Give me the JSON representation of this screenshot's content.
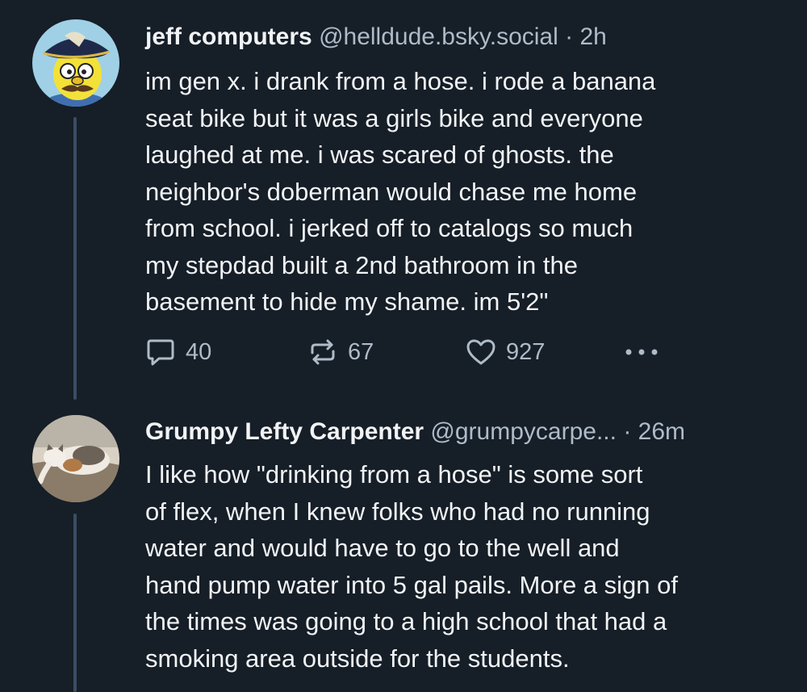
{
  "thread": {
    "root": {
      "author": {
        "display_name": "jeff computers",
        "handle": "@helldude.bsky.social",
        "separator": "·",
        "time": "2h"
      },
      "text": "im gen x. i drank from a hose. i rode a banana\nseat bike but it was a girls bike and everyone\nlaughed at me. i was scared of ghosts. the\nneighbor's doberman would chase me home\nfrom school. i jerked off to catalogs so much\nmy stepdad built a 2nd bathroom in the\nbasement to hide my shame. im 5'2\"",
      "actions": {
        "reply_count": "40",
        "repost_count": "67",
        "like_count": "927",
        "reply_icon": "speech-bubble-icon",
        "repost_icon": "repost-arrows-icon",
        "like_icon": "heart-icon",
        "more_icon": "ellipsis-icon"
      }
    },
    "reply": {
      "author": {
        "display_name": "Grumpy Lefty Carpenter",
        "handle": "@grumpycarpe...",
        "separator": "·",
        "time": "26m"
      },
      "text": "I like how \"drinking from a hose\" is  some sort\nof flex, when I knew folks who had no running\nwater and would have to go to the well and\nhand pump water into 5 gal pails. More a sign of\nthe times was going to a high school that had a\nsmoking area outside for the students."
    }
  },
  "colors": {
    "background": "#161e27",
    "text_primary": "#f1f3f5",
    "text_secondary": "#aebbc9",
    "thread_line": "#3b4d63"
  }
}
